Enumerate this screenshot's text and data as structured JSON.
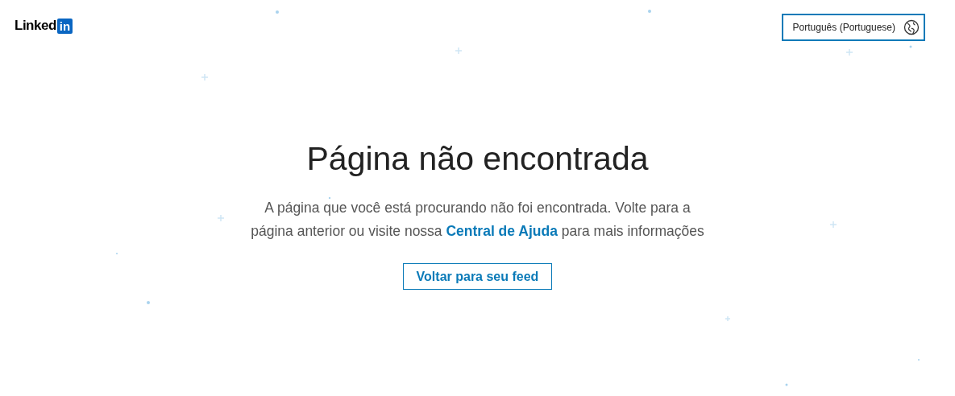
{
  "header": {
    "logo": {
      "word": "Linked",
      "badge": "in"
    },
    "language_button": {
      "label": "Português (Portuguese)"
    }
  },
  "main": {
    "title": "Página não encontrada",
    "message": "A página que você está procurando não foi encontrada. Volte para a página anterior ou visite nossa",
    "link": "Central de Ajuda",
    "message_end": "para mais informações",
    "button": "Voltar para seu feed"
  }
}
